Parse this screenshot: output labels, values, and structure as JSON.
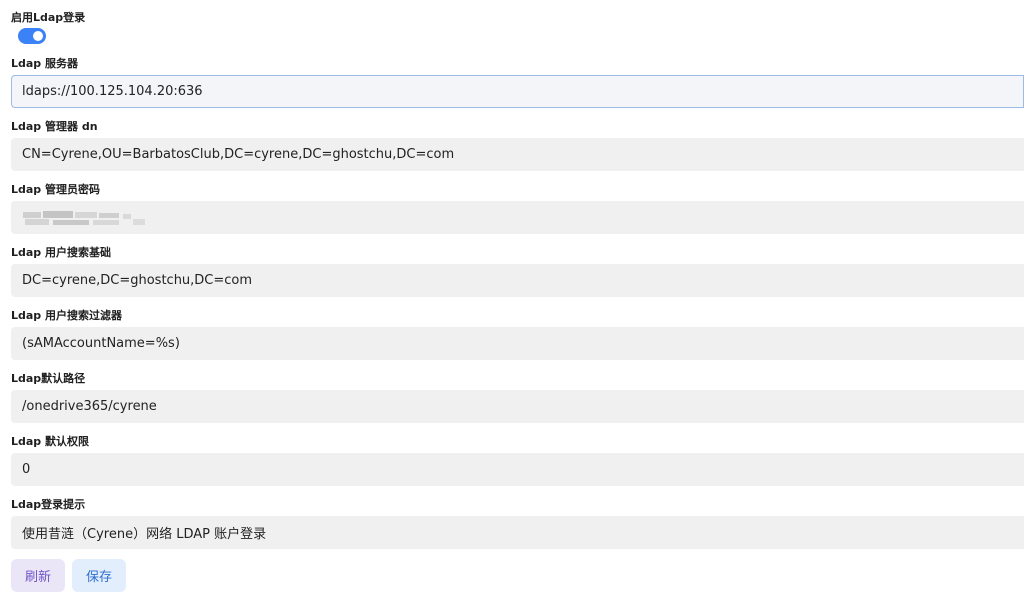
{
  "fields": {
    "enable_ldap": {
      "label": "启用Ldap登录",
      "enabled": true
    },
    "server": {
      "label": "Ldap 服务器",
      "value": "ldaps://100.125.104.20:636"
    },
    "manager_dn": {
      "label": "Ldap 管理器 dn",
      "value": "CN=Cyrene,OU=BarbatosClub,DC=cyrene,DC=ghostchu,DC=com"
    },
    "manager_password": {
      "label": "Ldap 管理员密码"
    },
    "user_search_base": {
      "label": "Ldap 用户搜索基础",
      "value": "DC=cyrene,DC=ghostchu,DC=com"
    },
    "user_search_filter": {
      "label": "Ldap 用户搜索过滤器",
      "value": "(sAMAccountName=%s)"
    },
    "default_path": {
      "label": "Ldap默认路径",
      "value": "/onedrive365/cyrene"
    },
    "default_permission": {
      "label": "Ldap 默认权限",
      "value": "0"
    },
    "login_hint": {
      "label": "Ldap登录提示",
      "value": "使用昔涟（Cyrene）网络 LDAP 账户登录"
    }
  },
  "buttons": {
    "refresh": "刷新",
    "save": "保存"
  },
  "colors": {
    "toggle_on": "#3b82f6",
    "input_bg": "#f0f0f0",
    "refresh_bg": "#ebe6f7",
    "refresh_text": "#6f56c7",
    "save_bg": "#e3eefc",
    "save_text": "#2f6fd1"
  }
}
